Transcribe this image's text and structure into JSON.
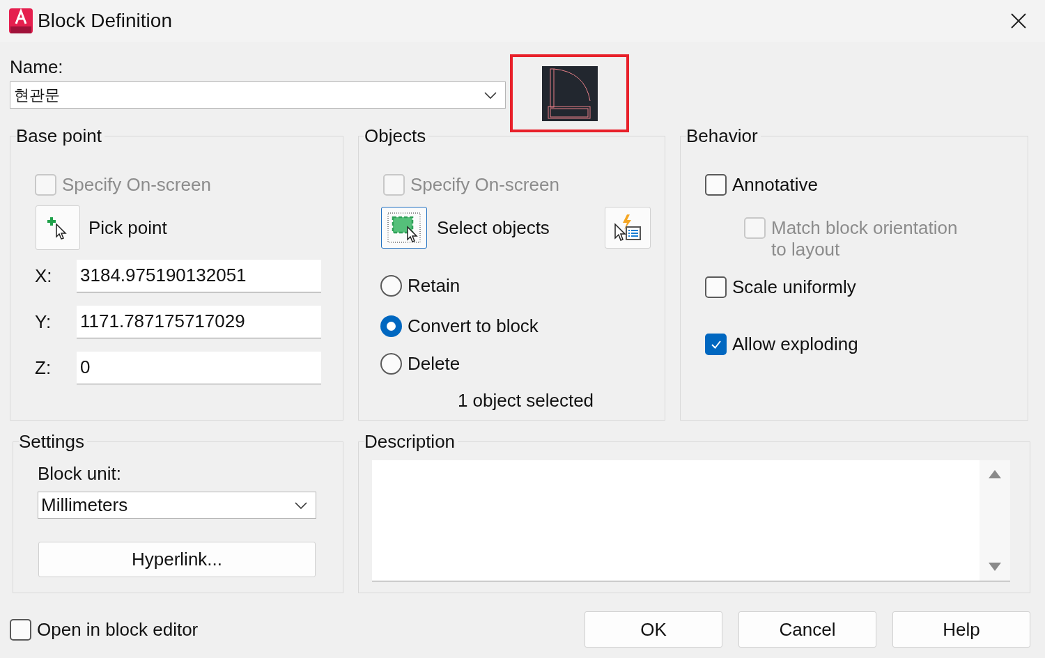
{
  "window": {
    "title": "Block Definition"
  },
  "name": {
    "label": "Name:",
    "value": "현관문"
  },
  "preview": {
    "highlighted": true
  },
  "base_point": {
    "title": "Base point",
    "specify": {
      "label": "Specify On-screen",
      "checked": false,
      "disabled": true
    },
    "pick_point": {
      "label": "Pick point"
    },
    "coords": [
      {
        "label": "X:",
        "value": "3184.975190132051"
      },
      {
        "label": "Y:",
        "value": "1171.787175717029"
      },
      {
        "label": "Z:",
        "value": "0"
      }
    ]
  },
  "objects": {
    "title": "Objects",
    "specify": {
      "label": "Specify On-screen",
      "checked": false,
      "disabled": true
    },
    "select_objects": {
      "label": "Select objects"
    },
    "options": [
      {
        "label": "Retain",
        "selected": false
      },
      {
        "label": "Convert to block",
        "selected": true
      },
      {
        "label": "Delete",
        "selected": false
      }
    ],
    "status": "1 object selected"
  },
  "behavior": {
    "title": "Behavior",
    "options": [
      {
        "label": "Annotative",
        "checked": false,
        "disabled": false,
        "children": [
          {
            "label": "Match block orientation to layout",
            "checked": false,
            "disabled": true
          }
        ]
      },
      {
        "label": "Scale uniformly",
        "checked": false,
        "disabled": false
      },
      {
        "label": "Allow exploding",
        "checked": true,
        "disabled": false
      }
    ]
  },
  "settings": {
    "title": "Settings",
    "block_unit": {
      "label": "Block unit:",
      "value": "Millimeters"
    },
    "hyperlink": {
      "label": "Hyperlink..."
    }
  },
  "description": {
    "title": "Description"
  },
  "open_in_editor": {
    "label": "Open in block editor",
    "checked": false
  },
  "buttons": [
    {
      "label": "OK"
    },
    {
      "label": "Cancel"
    },
    {
      "label": "Help"
    }
  ]
}
